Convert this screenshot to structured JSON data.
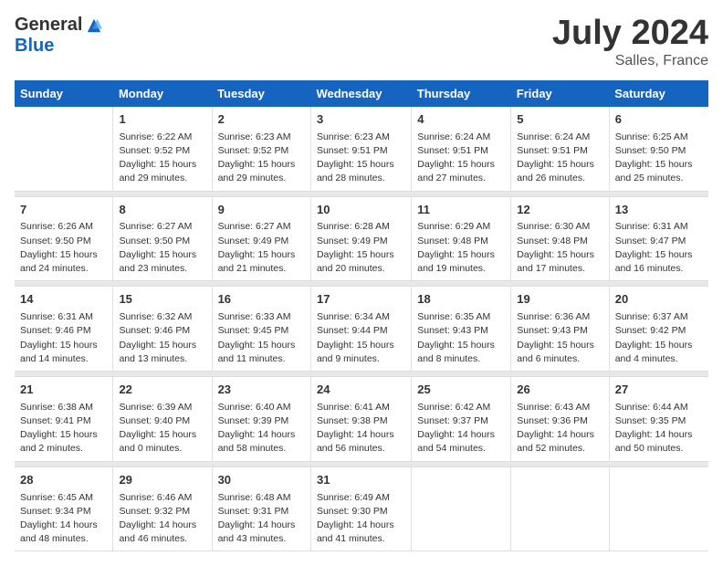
{
  "logo": {
    "general": "General",
    "blue": "Blue"
  },
  "title": {
    "month_year": "July 2024",
    "location": "Salles, France"
  },
  "headers": [
    "Sunday",
    "Monday",
    "Tuesday",
    "Wednesday",
    "Thursday",
    "Friday",
    "Saturday"
  ],
  "weeks": [
    [
      {
        "day": "",
        "sunrise": "",
        "sunset": "",
        "daylight": ""
      },
      {
        "day": "1",
        "sunrise": "Sunrise: 6:22 AM",
        "sunset": "Sunset: 9:52 PM",
        "daylight": "Daylight: 15 hours and 29 minutes."
      },
      {
        "day": "2",
        "sunrise": "Sunrise: 6:23 AM",
        "sunset": "Sunset: 9:52 PM",
        "daylight": "Daylight: 15 hours and 29 minutes."
      },
      {
        "day": "3",
        "sunrise": "Sunrise: 6:23 AM",
        "sunset": "Sunset: 9:51 PM",
        "daylight": "Daylight: 15 hours and 28 minutes."
      },
      {
        "day": "4",
        "sunrise": "Sunrise: 6:24 AM",
        "sunset": "Sunset: 9:51 PM",
        "daylight": "Daylight: 15 hours and 27 minutes."
      },
      {
        "day": "5",
        "sunrise": "Sunrise: 6:24 AM",
        "sunset": "Sunset: 9:51 PM",
        "daylight": "Daylight: 15 hours and 26 minutes."
      },
      {
        "day": "6",
        "sunrise": "Sunrise: 6:25 AM",
        "sunset": "Sunset: 9:50 PM",
        "daylight": "Daylight: 15 hours and 25 minutes."
      }
    ],
    [
      {
        "day": "7",
        "sunrise": "Sunrise: 6:26 AM",
        "sunset": "Sunset: 9:50 PM",
        "daylight": "Daylight: 15 hours and 24 minutes."
      },
      {
        "day": "8",
        "sunrise": "Sunrise: 6:27 AM",
        "sunset": "Sunset: 9:50 PM",
        "daylight": "Daylight: 15 hours and 23 minutes."
      },
      {
        "day": "9",
        "sunrise": "Sunrise: 6:27 AM",
        "sunset": "Sunset: 9:49 PM",
        "daylight": "Daylight: 15 hours and 21 minutes."
      },
      {
        "day": "10",
        "sunrise": "Sunrise: 6:28 AM",
        "sunset": "Sunset: 9:49 PM",
        "daylight": "Daylight: 15 hours and 20 minutes."
      },
      {
        "day": "11",
        "sunrise": "Sunrise: 6:29 AM",
        "sunset": "Sunset: 9:48 PM",
        "daylight": "Daylight: 15 hours and 19 minutes."
      },
      {
        "day": "12",
        "sunrise": "Sunrise: 6:30 AM",
        "sunset": "Sunset: 9:48 PM",
        "daylight": "Daylight: 15 hours and 17 minutes."
      },
      {
        "day": "13",
        "sunrise": "Sunrise: 6:31 AM",
        "sunset": "Sunset: 9:47 PM",
        "daylight": "Daylight: 15 hours and 16 minutes."
      }
    ],
    [
      {
        "day": "14",
        "sunrise": "Sunrise: 6:31 AM",
        "sunset": "Sunset: 9:46 PM",
        "daylight": "Daylight: 15 hours and 14 minutes."
      },
      {
        "day": "15",
        "sunrise": "Sunrise: 6:32 AM",
        "sunset": "Sunset: 9:46 PM",
        "daylight": "Daylight: 15 hours and 13 minutes."
      },
      {
        "day": "16",
        "sunrise": "Sunrise: 6:33 AM",
        "sunset": "Sunset: 9:45 PM",
        "daylight": "Daylight: 15 hours and 11 minutes."
      },
      {
        "day": "17",
        "sunrise": "Sunrise: 6:34 AM",
        "sunset": "Sunset: 9:44 PM",
        "daylight": "Daylight: 15 hours and 9 minutes."
      },
      {
        "day": "18",
        "sunrise": "Sunrise: 6:35 AM",
        "sunset": "Sunset: 9:43 PM",
        "daylight": "Daylight: 15 hours and 8 minutes."
      },
      {
        "day": "19",
        "sunrise": "Sunrise: 6:36 AM",
        "sunset": "Sunset: 9:43 PM",
        "daylight": "Daylight: 15 hours and 6 minutes."
      },
      {
        "day": "20",
        "sunrise": "Sunrise: 6:37 AM",
        "sunset": "Sunset: 9:42 PM",
        "daylight": "Daylight: 15 hours and 4 minutes."
      }
    ],
    [
      {
        "day": "21",
        "sunrise": "Sunrise: 6:38 AM",
        "sunset": "Sunset: 9:41 PM",
        "daylight": "Daylight: 15 hours and 2 minutes."
      },
      {
        "day": "22",
        "sunrise": "Sunrise: 6:39 AM",
        "sunset": "Sunset: 9:40 PM",
        "daylight": "Daylight: 15 hours and 0 minutes."
      },
      {
        "day": "23",
        "sunrise": "Sunrise: 6:40 AM",
        "sunset": "Sunset: 9:39 PM",
        "daylight": "Daylight: 14 hours and 58 minutes."
      },
      {
        "day": "24",
        "sunrise": "Sunrise: 6:41 AM",
        "sunset": "Sunset: 9:38 PM",
        "daylight": "Daylight: 14 hours and 56 minutes."
      },
      {
        "day": "25",
        "sunrise": "Sunrise: 6:42 AM",
        "sunset": "Sunset: 9:37 PM",
        "daylight": "Daylight: 14 hours and 54 minutes."
      },
      {
        "day": "26",
        "sunrise": "Sunrise: 6:43 AM",
        "sunset": "Sunset: 9:36 PM",
        "daylight": "Daylight: 14 hours and 52 minutes."
      },
      {
        "day": "27",
        "sunrise": "Sunrise: 6:44 AM",
        "sunset": "Sunset: 9:35 PM",
        "daylight": "Daylight: 14 hours and 50 minutes."
      }
    ],
    [
      {
        "day": "28",
        "sunrise": "Sunrise: 6:45 AM",
        "sunset": "Sunset: 9:34 PM",
        "daylight": "Daylight: 14 hours and 48 minutes."
      },
      {
        "day": "29",
        "sunrise": "Sunrise: 6:46 AM",
        "sunset": "Sunset: 9:32 PM",
        "daylight": "Daylight: 14 hours and 46 minutes."
      },
      {
        "day": "30",
        "sunrise": "Sunrise: 6:48 AM",
        "sunset": "Sunset: 9:31 PM",
        "daylight": "Daylight: 14 hours and 43 minutes."
      },
      {
        "day": "31",
        "sunrise": "Sunrise: 6:49 AM",
        "sunset": "Sunset: 9:30 PM",
        "daylight": "Daylight: 14 hours and 41 minutes."
      },
      {
        "day": "",
        "sunrise": "",
        "sunset": "",
        "daylight": ""
      },
      {
        "day": "",
        "sunrise": "",
        "sunset": "",
        "daylight": ""
      },
      {
        "day": "",
        "sunrise": "",
        "sunset": "",
        "daylight": ""
      }
    ]
  ]
}
